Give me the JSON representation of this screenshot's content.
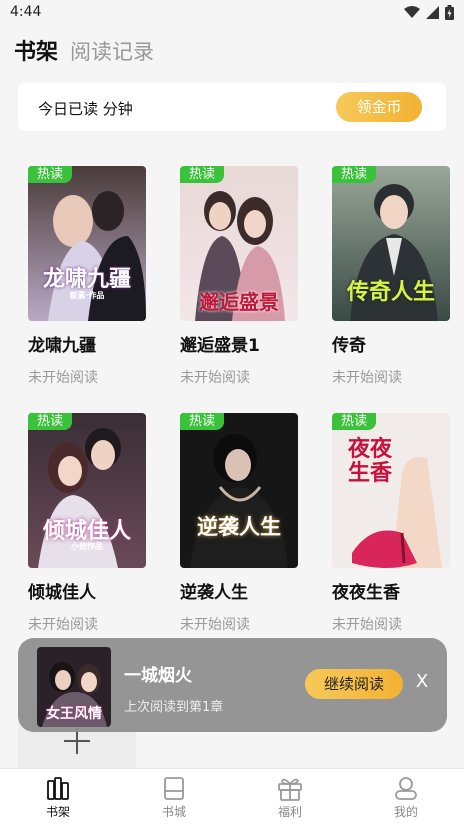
{
  "status_bar": {
    "time": "4:44"
  },
  "tabs": {
    "bookshelf": "书架",
    "history": "阅读记录"
  },
  "reading": {
    "summary": "今日已读  分钟",
    "coin_button": "领金币"
  },
  "hot_label": "热读",
  "books": [
    {
      "title": "龙啸九疆",
      "status": "未开始阅读",
      "cover_text": "龙啸九疆",
      "cover_sub": "叙素·作品",
      "hot": true
    },
    {
      "title": "邂逅盛景1",
      "status": "未开始阅读",
      "cover_text": "邂逅盛景",
      "cover_sub": "",
      "hot": true
    },
    {
      "title": "传奇",
      "status": "未开始阅读",
      "cover_text": "传奇人生",
      "cover_sub": "",
      "hot": true
    },
    {
      "title": "倾城佳人",
      "status": "未开始阅读",
      "cover_text": "倾城佳人",
      "cover_sub": "小依作品",
      "hot": true
    },
    {
      "title": "逆袭人生",
      "status": "未开始阅读",
      "cover_text": "逆袭人生",
      "cover_sub": "",
      "hot": true
    },
    {
      "title": "夜夜生香",
      "status": "未开始阅读",
      "cover_text": "夜夜生香",
      "cover_sub": "",
      "hot": true
    }
  ],
  "continue_reading": {
    "title": "一城烟火",
    "subtitle": "上次阅读到第1章",
    "button": "继续阅读",
    "close": "X",
    "cover_text": "女王风情"
  },
  "nav": [
    {
      "label": "书架",
      "icon": "bookshelf-icon",
      "active": true
    },
    {
      "label": "书城",
      "icon": "bookstore-icon",
      "active": false
    },
    {
      "label": "福利",
      "icon": "gift-icon",
      "active": false
    },
    {
      "label": "我的",
      "icon": "profile-icon",
      "active": false
    }
  ],
  "colors": {
    "accent": "#f2b233",
    "hot_badge": "#3bc23b",
    "background": "#f5f5f5"
  }
}
